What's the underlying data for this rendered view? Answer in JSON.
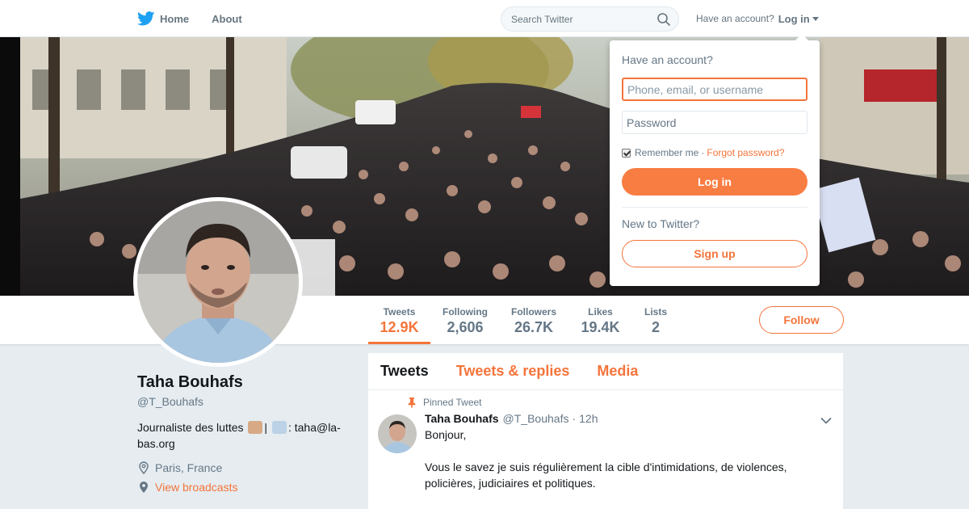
{
  "nav": {
    "home_label": "Home",
    "about_label": "About",
    "search_placeholder": "Search Twitter",
    "have_account": "Have an account?",
    "login_label": "Log in"
  },
  "banner": {
    "description_icon": "crowd-photo"
  },
  "stats": [
    {
      "label": "Tweets",
      "value": "12.9K"
    },
    {
      "label": "Following",
      "value": "2,606"
    },
    {
      "label": "Followers",
      "value": "26.7K"
    },
    {
      "label": "Likes",
      "value": "19.4K"
    },
    {
      "label": "Lists",
      "value": "2"
    }
  ],
  "follow_label": "Follow",
  "profile": {
    "name": "Taha Bouhafs",
    "handle": "@T_Bouhafs",
    "bio_part1": "Journaliste des luttes",
    "bio_part2": "|",
    "bio_part3": ": taha@la-bas.org",
    "location": "Paris, France",
    "broadcasts": "View broadcasts"
  },
  "timeline": {
    "tabs": [
      "Tweets",
      "Tweets & replies",
      "Media"
    ]
  },
  "tweet": {
    "pinned_label": "Pinned Tweet",
    "name": "Taha Bouhafs",
    "handle": "@T_Bouhafs",
    "dot": "·",
    "time": "12h",
    "text": "Bonjour,\n\nVous le savez je suis régulièrement la cible d'intimidations, de violences, policières, judiciaires et politiques."
  },
  "login_dropdown": {
    "title": "Have an account?",
    "username_placeholder": "Phone, email, or username",
    "password_placeholder": "Password",
    "remember_label": "Remember me",
    "separator": "·",
    "forgot_label": "Forgot password?",
    "login_button": "Log in",
    "new_label": "New to Twitter?",
    "signup_button": "Sign up"
  },
  "colors": {
    "accent": "#f4743b",
    "twitter_blue": "#1da1f2",
    "background": "#e6ecf0"
  }
}
